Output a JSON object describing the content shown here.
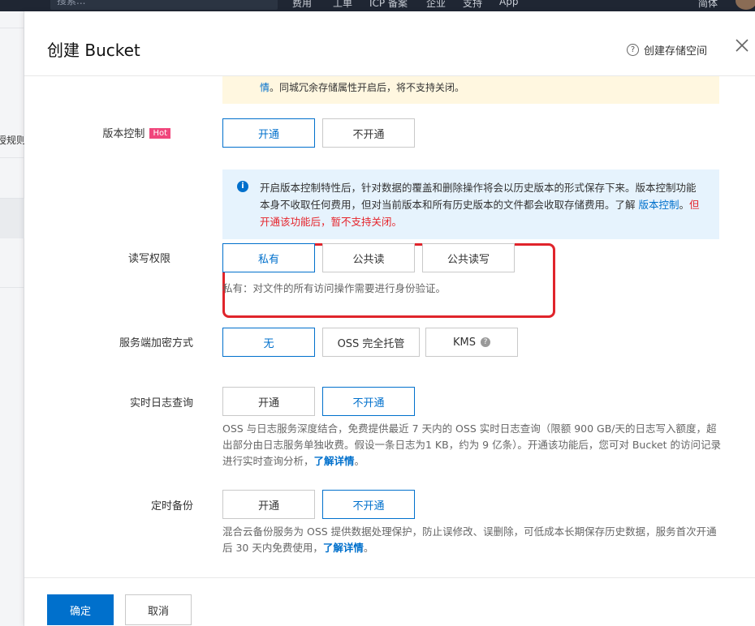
{
  "background": {
    "search_placeholder": "搜索...",
    "nav_items": [
      "费用",
      "工单",
      "ICP 备案",
      "企业",
      "支持",
      "App"
    ],
    "lang": "简体",
    "sidebar_cut_text": "授规则"
  },
  "panel": {
    "title": "创建 Bucket",
    "help_link": "创建存储空间"
  },
  "redundancy_notice": {
    "link": "情",
    "text": "。同城冗余存储属性开启后，将不支持关闭。"
  },
  "versioning": {
    "label": "版本控制",
    "badge": "Hot",
    "options": [
      "开通",
      "不开通"
    ],
    "selected": "开通",
    "info_text": "开启版本控制特性后，针对数据的覆盖和删除操作将会以历史版本的形式保存下来。版本控制功能本身不收取任何费用，但对当前版本和所有历史版本的文件都会收取存储费用。了解 ",
    "info_link": "版本控制",
    "info_punct": "。",
    "info_warning": "但开通该功能后，暂不支持关闭。"
  },
  "acl": {
    "label": "读写权限",
    "options": [
      "私有",
      "公共读",
      "公共读写"
    ],
    "selected": "私有",
    "desc": "私有：对文件的所有访问操作需要进行身份验证。"
  },
  "encryption": {
    "label": "服务端加密方式",
    "options": [
      "无",
      "OSS 完全托管",
      "KMS"
    ],
    "selected": "无"
  },
  "realtime_log": {
    "label": "实时日志查询",
    "options": [
      "开通",
      "不开通"
    ],
    "selected": "不开通",
    "desc": "OSS 与日志服务深度结合，免费提供最近 7 天内的 OSS 实时日志查询（限额 900 GB/天的日志写入额度，超出部分由日志服务单独收费。假设一条日志为1 KB，约为 9 亿条）。开通该功能后，您可对 Bucket 的访问记录进行实时查询分析，",
    "link": "了解详情",
    "tail": "。"
  },
  "backup": {
    "label": "定时备份",
    "options": [
      "开通",
      "不开通"
    ],
    "selected": "不开通",
    "desc": "混合云备份服务为 OSS 提供数据处理保护，防止误修改、误删除，可低成本长期保存历史数据，服务首次开通后 30 天内免费使用，",
    "link": "了解详情",
    "tail": "。"
  },
  "footer": {
    "confirm": "确定",
    "cancel": "取消"
  },
  "colors": {
    "primary": "#0070cc",
    "hot_badge": "#f0467c",
    "highlight_box": "#e0242b",
    "info_bg": "#e6f3fd",
    "warn_bg": "#fff7e0"
  }
}
